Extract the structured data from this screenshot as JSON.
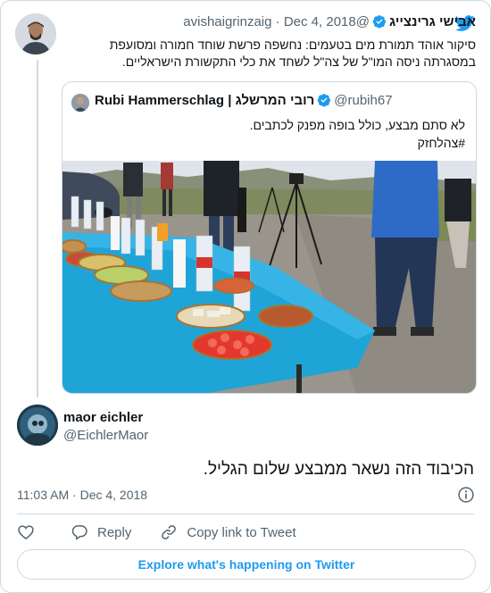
{
  "parent_tweet": {
    "author_name": "אבישי גרינצייג",
    "handle": "@avishaigrinzaig",
    "separator": "·",
    "date": "Dec 4, 2018",
    "text_line1": "סיקור אוהד תמורת מים בטעמים: נחשפה פרשת שוחד חמורה ומסועפת",
    "text_line2": "במסגרתה ניסה המו\"ל של צה\"ל לשחד את כלי התקשורת הישראליים."
  },
  "quoted_tweet": {
    "author_name": "Rubi Hammerschlag | רובי המרשלג",
    "handle": "@rubih67",
    "text_line1": "לא סתם מבצע, כולל בופה מפנק לכתבים.",
    "text_line2": "#צהלחזק"
  },
  "main_tweet": {
    "author_name": "maor eichler",
    "handle": "@EichlerMaor",
    "text": "הכיבוד הזה נשאר ממבצע שלום הגליל.",
    "time": "11:03 AM",
    "separator": "·",
    "date": "Dec 4, 2018"
  },
  "actions": {
    "reply_label": "Reply",
    "copy_link_label": "Copy link to Tweet"
  },
  "explore_label": "Explore what's happening on Twitter",
  "colors": {
    "twitter_blue": "#1d9bf0",
    "verified_blue": "#1d9bf0",
    "secondary_text": "#536471",
    "border": "#cfd9de",
    "tablecloth": "#1fa4d8"
  },
  "icons": [
    "twitter-logo-icon",
    "verified-icon",
    "info-icon",
    "heart-icon",
    "reply-icon",
    "link-icon"
  ]
}
